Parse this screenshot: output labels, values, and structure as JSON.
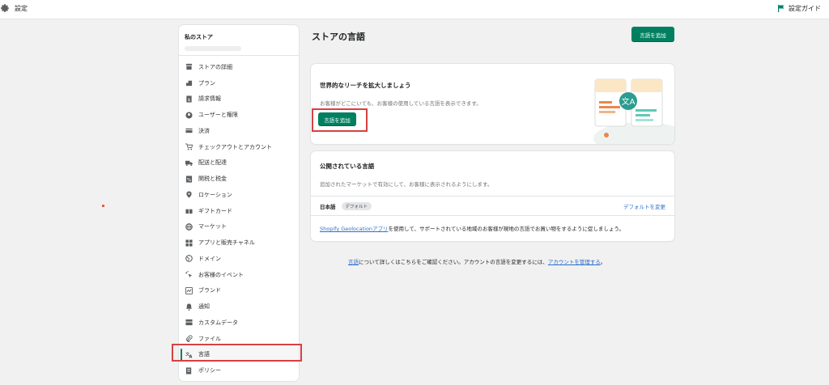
{
  "topbar": {
    "title": "設定",
    "guide_label": "設定ガイド"
  },
  "sidebar": {
    "store_name": "私のストア",
    "items": [
      {
        "label": "ストアの詳細",
        "icon": "store-icon"
      },
      {
        "label": "プラン",
        "icon": "plan-icon"
      },
      {
        "label": "請求情報",
        "icon": "billing-icon"
      },
      {
        "label": "ユーザーと権限",
        "icon": "user-icon"
      },
      {
        "label": "決済",
        "icon": "payment-icon"
      },
      {
        "label": "チェックアウトとアカウント",
        "icon": "cart-icon"
      },
      {
        "label": "配送と配達",
        "icon": "truck-icon"
      },
      {
        "label": "関税と税金",
        "icon": "tax-icon"
      },
      {
        "label": "ロケーション",
        "icon": "location-icon"
      },
      {
        "label": "ギフトカード",
        "icon": "gift-icon"
      },
      {
        "label": "マーケット",
        "icon": "globe-icon"
      },
      {
        "label": "アプリと販売チャネル",
        "icon": "apps-icon"
      },
      {
        "label": "ドメイン",
        "icon": "domain-icon"
      },
      {
        "label": "お客様のイベント",
        "icon": "events-icon"
      },
      {
        "label": "ブランド",
        "icon": "brand-icon"
      },
      {
        "label": "通知",
        "icon": "bell-icon"
      },
      {
        "label": "カスタムデータ",
        "icon": "custom-data-icon"
      },
      {
        "label": "ファイル",
        "icon": "paperclip-icon"
      },
      {
        "label": "言語",
        "icon": "translate-icon",
        "active": true
      },
      {
        "label": "ポリシー",
        "icon": "policy-icon"
      }
    ]
  },
  "main": {
    "title": "ストアの言語",
    "add_button": "言語を追加",
    "promo": {
      "title": "世界的なリーチを拡大しましょう",
      "description": "お客様がどこにいても、お客様の使用している言語を表示できます。",
      "button": "言語を追加"
    },
    "published": {
      "title": "公開されている言語",
      "description": "追加されたマーケットで有効にして、お客様に表示されるようにします。",
      "language": "日本語",
      "badge": "デフォルト",
      "change_link": "デフォルトを変更",
      "footer_link": "Shopify Geolocationアプリ",
      "footer_text": "を使用して、サポートされている地域のお客様が現地の言語でお買い物をするように促しましょう。"
    },
    "note": {
      "link1": "言語",
      "text": "について詳しくはこちらをご確認ください。アカウントの言語を変更するには、",
      "link2": "アカウントを管理する",
      "end": "。"
    }
  },
  "colors": {
    "accent": "#008060",
    "highlight": "#d94040",
    "link": "#2c6ecb"
  }
}
